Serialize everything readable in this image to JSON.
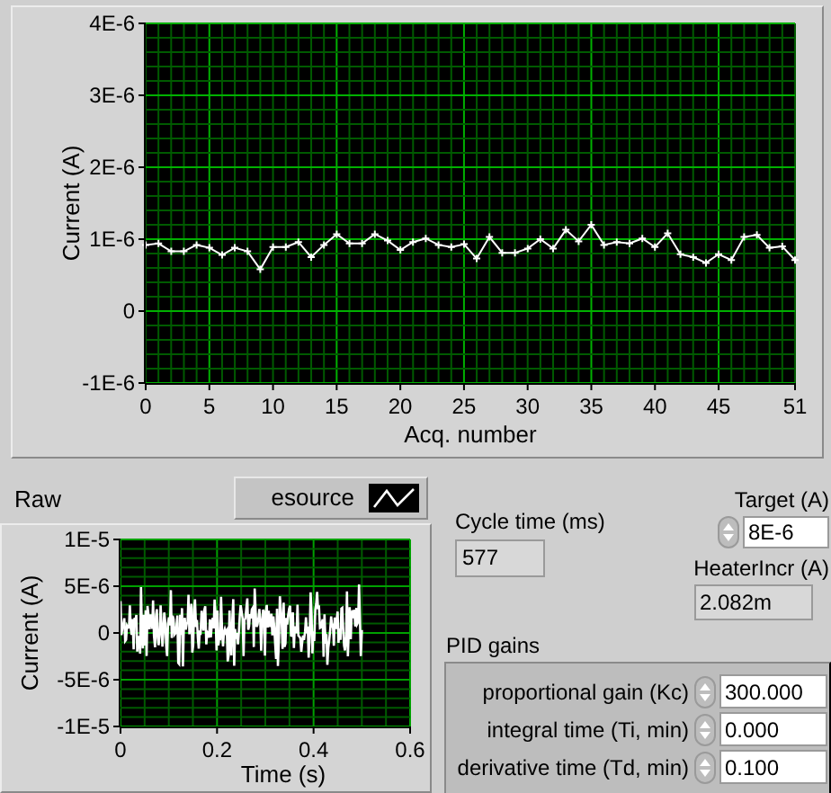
{
  "main_chart": {
    "chart_data": {
      "type": "line",
      "xlabel": "Acq. number",
      "ylabel": "Current (A)",
      "xlim": [
        0,
        51
      ],
      "ylim": [
        -1e-06,
        4e-06
      ],
      "xticks": [
        0,
        5,
        10,
        15,
        20,
        25,
        30,
        35,
        40,
        45,
        51
      ],
      "yticks": [
        {
          "value": -1e-06,
          "label": "-1E-6"
        },
        {
          "value": 0,
          "label": "0"
        },
        {
          "value": 1e-06,
          "label": "1E-6"
        },
        {
          "value": 2e-06,
          "label": "2E-6"
        },
        {
          "value": 3e-06,
          "label": "3E-6"
        },
        {
          "value": 4e-06,
          "label": "4E-6"
        }
      ],
      "x": [
        0,
        1,
        2,
        3,
        4,
        5,
        6,
        7,
        8,
        9,
        10,
        11,
        12,
        13,
        14,
        15,
        16,
        17,
        18,
        19,
        20,
        21,
        22,
        23,
        24,
        25,
        26,
        27,
        28,
        29,
        30,
        31,
        32,
        33,
        34,
        35,
        36,
        37,
        38,
        39,
        40,
        41,
        42,
        43,
        44,
        45,
        46,
        47,
        48,
        49,
        50,
        51
      ],
      "grid": true,
      "series": [
        {
          "color": "#ffffff",
          "marker": "+",
          "values": [
            9.2e-07,
            9.4e-07,
            8.3e-07,
            8.3e-07,
            9.2e-07,
            8.8e-07,
            7.8e-07,
            8.8e-07,
            8.3e-07,
            5.8e-07,
            8.9e-07,
            8.9e-07,
            9.6e-07,
            7.5e-07,
            9.2e-07,
            1.07e-06,
            9.4e-07,
            9.4e-07,
            1.07e-06,
            9.8e-07,
            8.5e-07,
            9.6e-07,
            1.01e-06,
            9.2e-07,
            8.9e-07,
            9.3e-07,
            7.3e-07,
            1.03e-06,
            8.1e-07,
            8.1e-07,
            8.7e-07,
            1e-06,
            8.7e-07,
            1.13e-06,
            9.7e-07,
            1.2e-06,
            9.2e-07,
            9.6e-07,
            9.4e-07,
            1.01e-06,
            8.9e-07,
            1.08e-06,
            7.9e-07,
            7.5e-07,
            6.7e-07,
            7.9e-07,
            7.1e-07,
            1.03e-06,
            1.06e-06,
            8.8e-07,
            9e-07,
            7.1e-07
          ]
        }
      ]
    }
  },
  "raw_graph": {
    "title": "Raw",
    "legend": "esource",
    "ylabel": "Current (A)",
    "xlabel": "Time (s)",
    "yticks": [
      "1E-5",
      "5E-6",
      "0",
      "-5E-6",
      "-1E-5"
    ],
    "xticks": [
      "0",
      "0.2",
      "0.4",
      "0.6"
    ]
  },
  "cycle_time": {
    "label": "Cycle time (ms)",
    "value": "577"
  },
  "target": {
    "label": "Target (A)",
    "value": "8E-6"
  },
  "heater_incr": {
    "label": "HeaterIncr (A)",
    "value": "2.082m"
  },
  "pid_gains": {
    "label": "PID gains",
    "rows": [
      {
        "label": "proportional gain (Kc)",
        "value": "300.000"
      },
      {
        "label": "integral time (Ti, min)",
        "value": "0.000"
      },
      {
        "label": "derivative time (Td, min)",
        "value": "0.100"
      }
    ]
  }
}
